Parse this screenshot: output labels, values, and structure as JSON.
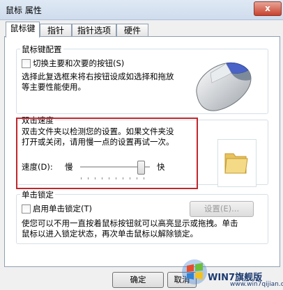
{
  "window": {
    "title": "鼠标 属性",
    "close_label": "x"
  },
  "tabs": [
    {
      "label": "鼠标键"
    },
    {
      "label": "指针"
    },
    {
      "label": "指针选项"
    },
    {
      "label": "硬件"
    }
  ],
  "button_config": {
    "group_title": "鼠标键配置",
    "switch_label": "切换主要和次要的按钮(S)",
    "desc_line1": "选择此复选框来将右按钮设成如选择和拖放",
    "desc_line2": "等主要性能使用。"
  },
  "double_click": {
    "group_title": "双击速度",
    "desc_line1": "双击文件夹以检测您的设置。如果文件夹没",
    "desc_line2": "打开或关闭，请用慢一点的设置再试一次。",
    "speed_label": "速度(D):",
    "slow_label": "慢",
    "fast_label": "快",
    "speed_fraction": 0.9
  },
  "click_lock": {
    "group_title": "单击锁定",
    "enable_label": "启用单击锁定(T)",
    "settings_label": "设置(E)...",
    "desc_line1": "使您可以不用一直按着鼠标按钮就可以高亮显示或拖拽。单击",
    "desc_line2": "鼠标以进入锁定状态，再次单击鼠标以解除锁定。"
  },
  "footer": {
    "ok_label": "确定",
    "cancel_label": "取消"
  },
  "watermark": {
    "text": "WIN7旗舰版",
    "url": "www.win7qijian.com"
  }
}
